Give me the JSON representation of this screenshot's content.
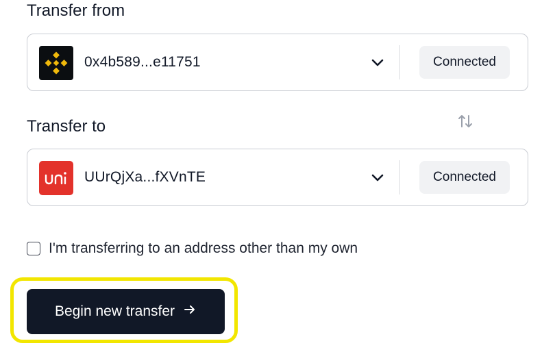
{
  "transfer_from": {
    "label": "Transfer from",
    "wallet_icon": "binance-logo-icon",
    "address": "0x4b589...e11751",
    "status": "Connected"
  },
  "transfer_to": {
    "label": "Transfer to",
    "wallet_icon": "uni-wallet-logo-icon",
    "address": "UUrQjXa...fXVnTE",
    "status": "Connected"
  },
  "swap_icon": "swap-arrows-icon",
  "checkbox": {
    "label": "I'm transferring to an address other than my own",
    "checked": false
  },
  "primary_button": {
    "label": "Begin new transfer",
    "icon": "arrow-right-icon"
  },
  "colors": {
    "primary": "#111827",
    "highlight": "#f2e600",
    "binance_gold": "#f0b90b",
    "uni_red": "#e3322b"
  }
}
